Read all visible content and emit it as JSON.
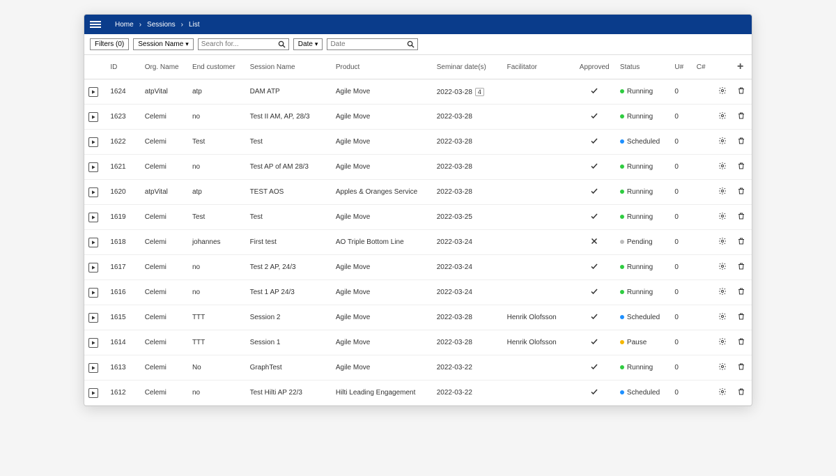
{
  "breadcrumb": {
    "home": "Home",
    "sessions": "Sessions",
    "list": "List"
  },
  "filters": {
    "button_label": "Filters (0)",
    "session_name_dropdown": "Session Name",
    "search_placeholder": "Search for...",
    "date_dropdown": "Date",
    "date_placeholder": "Date"
  },
  "columns": {
    "id": "ID",
    "org": "Org. Name",
    "endc": "End customer",
    "session": "Session Name",
    "product": "Product",
    "dates": "Seminar date(s)",
    "fac": "Facilitator",
    "approved": "Approved",
    "status": "Status",
    "us": "U#",
    "ce": "C#"
  },
  "status_labels": {
    "running": "Running",
    "scheduled": "Scheduled",
    "pending": "Pending",
    "pause": "Pause"
  },
  "rows": [
    {
      "id": "1624",
      "org": "atpVital",
      "endc": "atp",
      "session": "DAM ATP",
      "product": "Agile Move",
      "date": "2022-03-28",
      "badge": "4",
      "fac": "",
      "approved": true,
      "status": "running",
      "us": "0"
    },
    {
      "id": "1623",
      "org": "Celemi",
      "endc": "no",
      "session": "Test II AM, AP, 28/3",
      "product": "Agile Move",
      "date": "2022-03-28",
      "badge": "",
      "fac": "",
      "approved": true,
      "status": "running",
      "us": "0"
    },
    {
      "id": "1622",
      "org": "Celemi",
      "endc": "Test",
      "session": "Test",
      "product": "Agile Move",
      "date": "2022-03-28",
      "badge": "",
      "fac": "",
      "approved": true,
      "status": "scheduled",
      "us": "0"
    },
    {
      "id": "1621",
      "org": "Celemi",
      "endc": "no",
      "session": "Test AP of AM 28/3",
      "product": "Agile Move",
      "date": "2022-03-28",
      "badge": "",
      "fac": "",
      "approved": true,
      "status": "running",
      "us": "0"
    },
    {
      "id": "1620",
      "org": "atpVital",
      "endc": "atp",
      "session": "TEST AOS",
      "product": "Apples & Oranges Service",
      "date": "2022-03-28",
      "badge": "",
      "fac": "",
      "approved": true,
      "status": "running",
      "us": "0"
    },
    {
      "id": "1619",
      "org": "Celemi",
      "endc": "Test",
      "session": "Test",
      "product": "Agile Move",
      "date": "2022-03-25",
      "badge": "",
      "fac": "",
      "approved": true,
      "status": "running",
      "us": "0"
    },
    {
      "id": "1618",
      "org": "Celemi",
      "endc": "johannes",
      "session": "First test",
      "product": "AO Triple Bottom Line",
      "date": "2022-03-24",
      "badge": "",
      "fac": "",
      "approved": false,
      "status": "pending",
      "us": "0"
    },
    {
      "id": "1617",
      "org": "Celemi",
      "endc": "no",
      "session": "Test 2 AP, 24/3",
      "product": "Agile Move",
      "date": "2022-03-24",
      "badge": "",
      "fac": "",
      "approved": true,
      "status": "running",
      "us": "0"
    },
    {
      "id": "1616",
      "org": "Celemi",
      "endc": "no",
      "session": "Test 1 AP 24/3",
      "product": "Agile Move",
      "date": "2022-03-24",
      "badge": "",
      "fac": "",
      "approved": true,
      "status": "running",
      "us": "0"
    },
    {
      "id": "1615",
      "org": "Celemi",
      "endc": "TTT",
      "session": "Session 2",
      "product": "Agile Move",
      "date": "2022-03-28",
      "badge": "",
      "fac": "Henrik Olofsson",
      "approved": true,
      "status": "scheduled",
      "us": "0"
    },
    {
      "id": "1614",
      "org": "Celemi",
      "endc": "TTT",
      "session": "Session 1",
      "product": "Agile Move",
      "date": "2022-03-28",
      "badge": "",
      "fac": "Henrik Olofsson",
      "approved": true,
      "status": "pause",
      "us": "0"
    },
    {
      "id": "1613",
      "org": "Celemi",
      "endc": "No",
      "session": "GraphTest",
      "product": "Agile Move",
      "date": "2022-03-22",
      "badge": "",
      "fac": "",
      "approved": true,
      "status": "running",
      "us": "0"
    },
    {
      "id": "1612",
      "org": "Celemi",
      "endc": "no",
      "session": "Test Hilti AP 22/3",
      "product": "Hilti Leading Engagement",
      "date": "2022-03-22",
      "badge": "",
      "fac": "",
      "approved": true,
      "status": "scheduled",
      "us": "0"
    }
  ]
}
